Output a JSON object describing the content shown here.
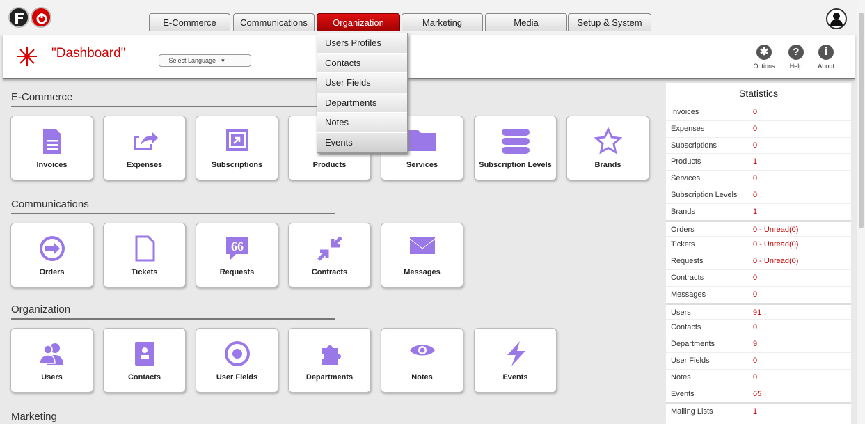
{
  "nav": {
    "tabs": [
      "E-Commerce",
      "Communications",
      "Organization",
      "Marketing",
      "Media",
      "Setup & System"
    ],
    "active_tab": "Organization",
    "dropdown": [
      "Users Profiles",
      "Contacts",
      "User Fields",
      "Departments",
      "Notes",
      "Events"
    ]
  },
  "header": {
    "title": "\"Dashboard\"",
    "language_select": "- Select Language -",
    "icons": [
      {
        "label": "Options",
        "icon": "gear-icon"
      },
      {
        "label": "Help",
        "icon": "help-icon"
      },
      {
        "label": "About",
        "icon": "info-icon"
      }
    ]
  },
  "sections": [
    {
      "title": "E-Commerce",
      "tiles": [
        {
          "label": "Invoices",
          "icon": "document-icon"
        },
        {
          "label": "Expenses",
          "icon": "share-icon"
        },
        {
          "label": "Subscriptions",
          "icon": "external-link-icon"
        },
        {
          "label": "Products",
          "icon": "box-icon"
        },
        {
          "label": "Services",
          "icon": "folder-icon"
        },
        {
          "label": "Subscription Levels",
          "icon": "stack-icon"
        },
        {
          "label": "Brands",
          "icon": "star-icon"
        }
      ]
    },
    {
      "title": "Communications",
      "tiles": [
        {
          "label": "Orders",
          "icon": "arrow-circle-icon"
        },
        {
          "label": "Tickets",
          "icon": "page-icon"
        },
        {
          "label": "Requests",
          "icon": "quote-bubble-icon"
        },
        {
          "label": "Contracts",
          "icon": "compress-icon"
        },
        {
          "label": "Messages",
          "icon": "envelope-icon"
        }
      ]
    },
    {
      "title": "Organization",
      "tiles": [
        {
          "label": "Users",
          "icon": "users-icon"
        },
        {
          "label": "Contacts",
          "icon": "contact-card-icon"
        },
        {
          "label": "User Fields",
          "icon": "target-icon"
        },
        {
          "label": "Departments",
          "icon": "puzzle-icon"
        },
        {
          "label": "Notes",
          "icon": "eye-icon"
        },
        {
          "label": "Events",
          "icon": "lightning-icon"
        }
      ]
    },
    {
      "title": "Marketing",
      "tiles": []
    }
  ],
  "statistics": {
    "title": "Statistics",
    "groups": [
      [
        [
          "Invoices",
          "0"
        ],
        [
          "Expenses",
          "0"
        ],
        [
          "Subscriptions",
          "0"
        ],
        [
          "Products",
          "1"
        ],
        [
          "Services",
          "0"
        ],
        [
          "Subscription Levels",
          "0"
        ],
        [
          "Brands",
          "1"
        ]
      ],
      [
        [
          "Orders",
          "0 - Unread(0)"
        ],
        [
          "Tickets",
          "0 - Unread(0)"
        ],
        [
          "Requests",
          "0 - Unread(0)"
        ],
        [
          "Contracts",
          "0"
        ],
        [
          "Messages",
          "0"
        ]
      ],
      [
        [
          "Users",
          "91"
        ],
        [
          "Contacts",
          "0"
        ],
        [
          "Departments",
          "9"
        ],
        [
          "User Fields",
          "0"
        ],
        [
          "Notes",
          "0"
        ],
        [
          "Events",
          "65"
        ]
      ],
      [
        [
          "Mailing Lists",
          "1"
        ]
      ]
    ]
  },
  "colors": {
    "accent": "#d00000",
    "tile_icon": "#9b78e8",
    "value": "#cc0000"
  }
}
